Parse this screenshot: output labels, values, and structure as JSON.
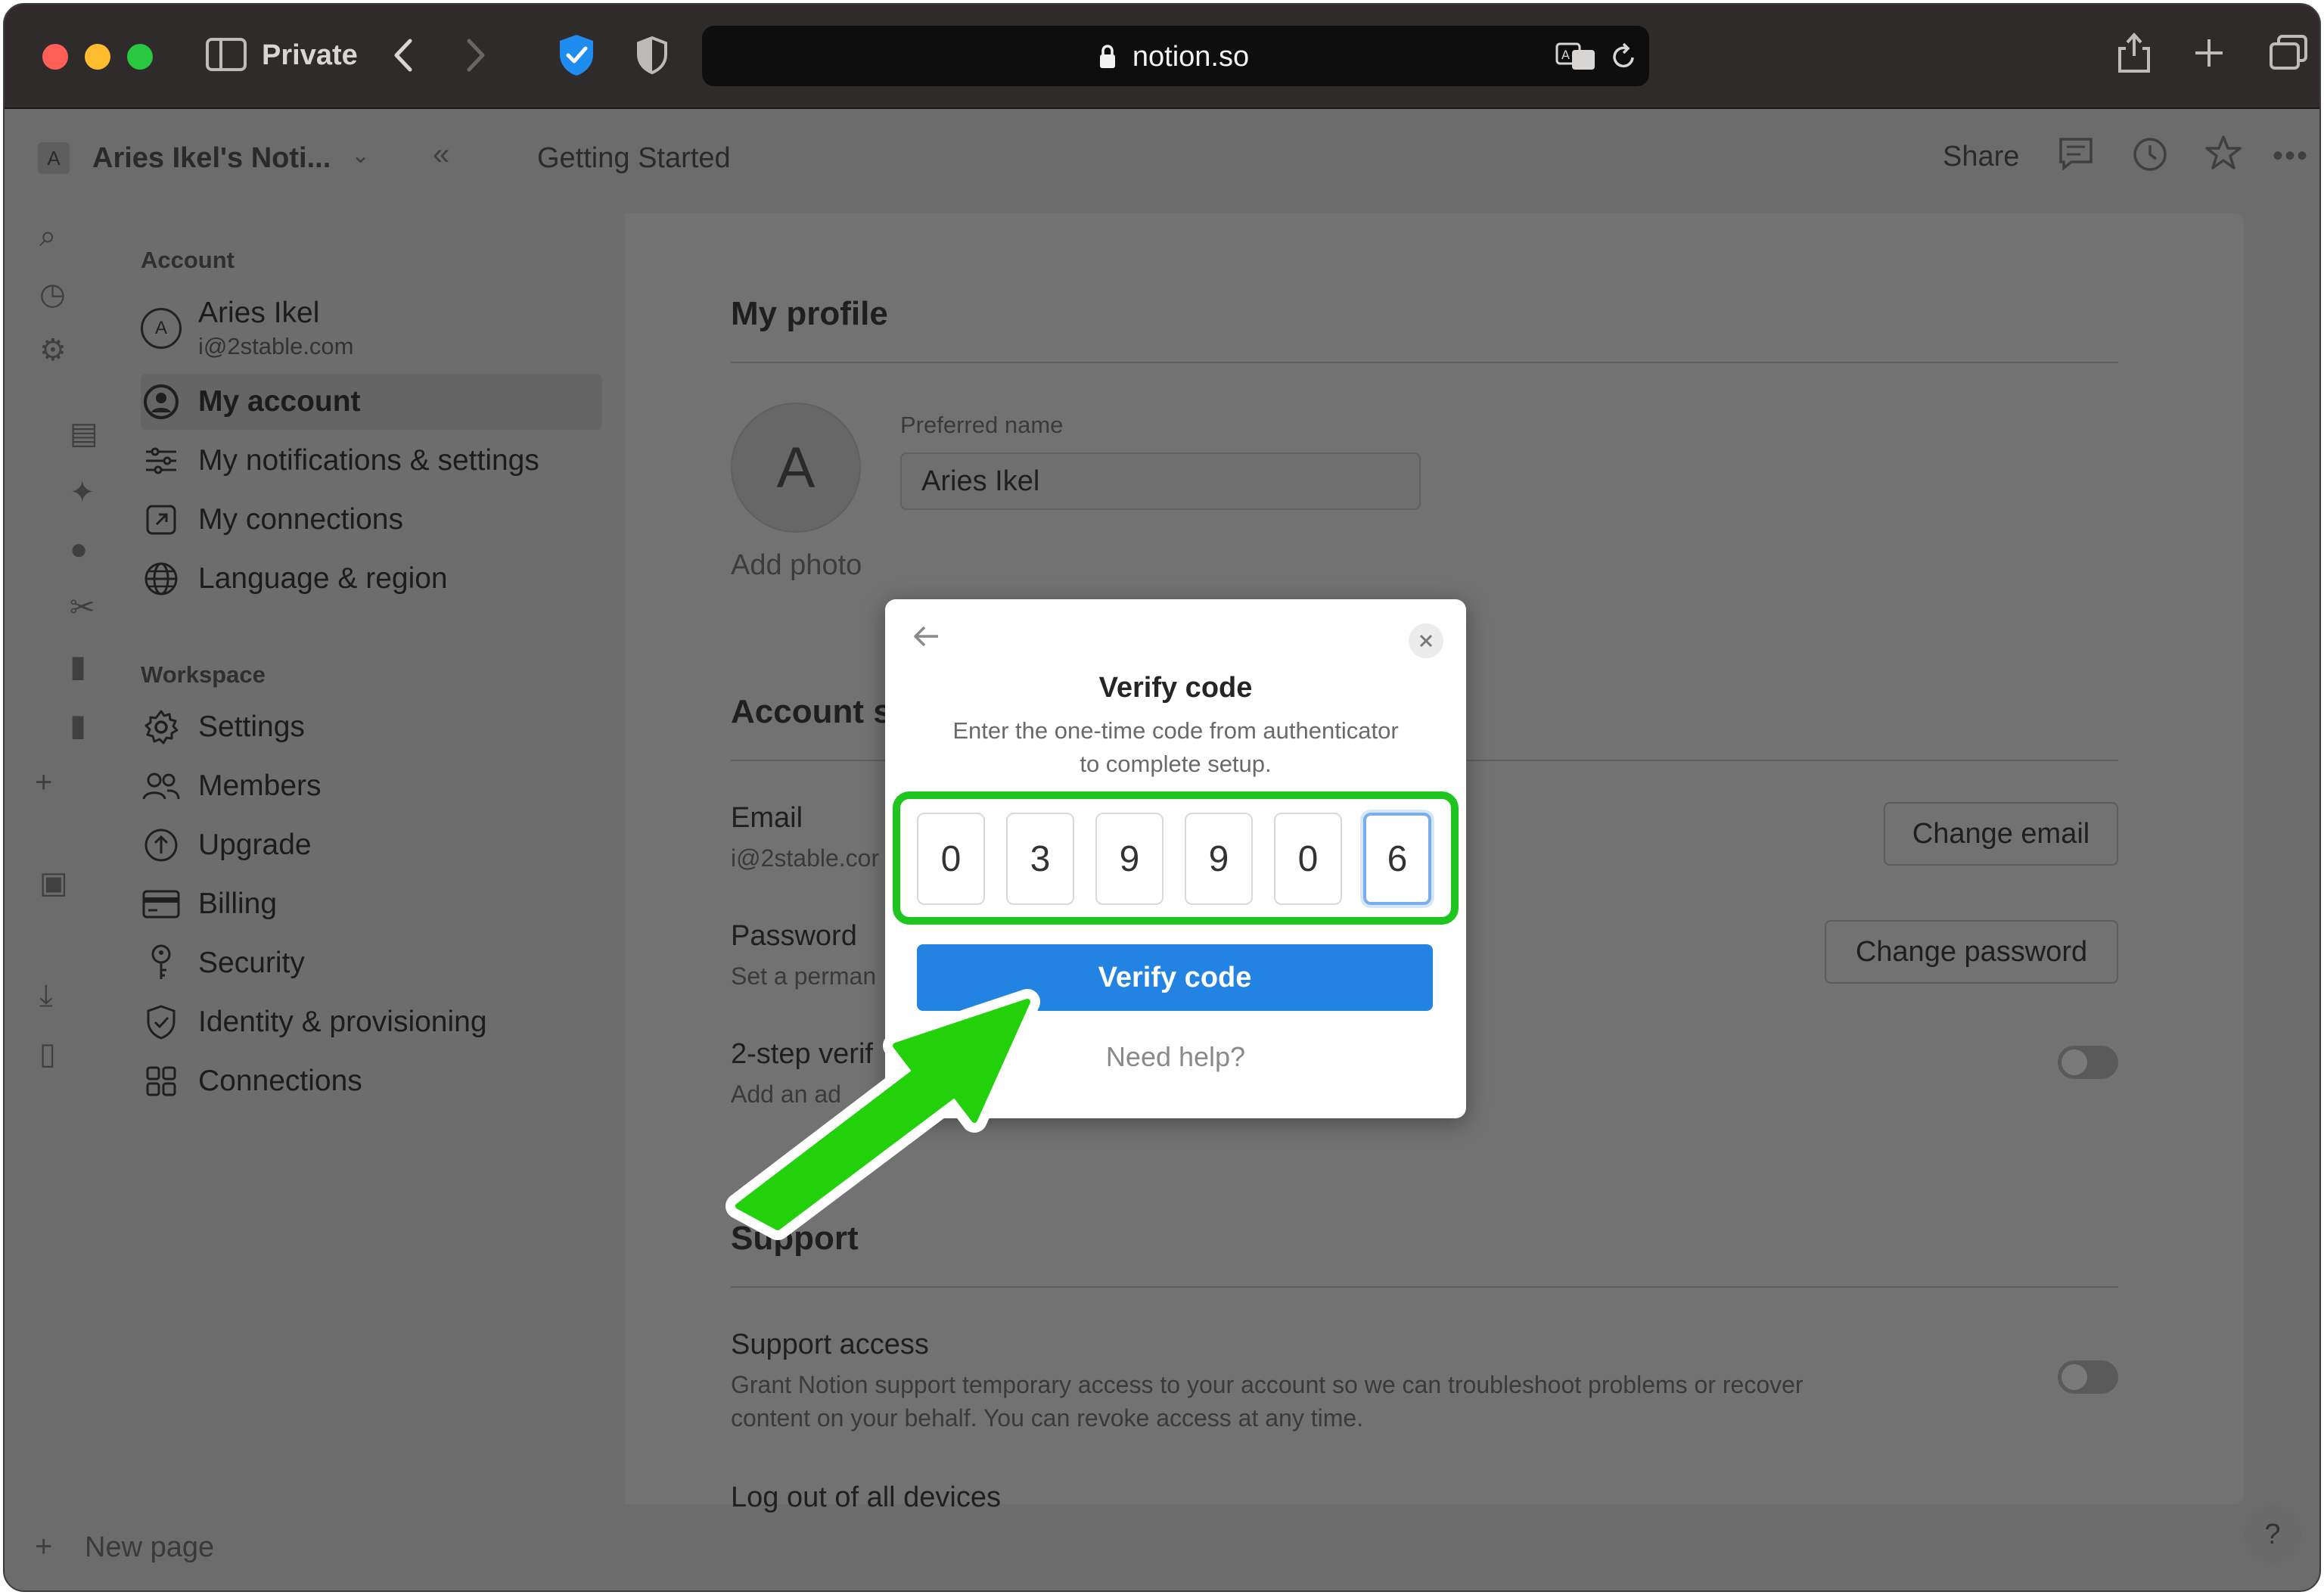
{
  "browser": {
    "profile_label": "Private",
    "address": "notion.so"
  },
  "notion": {
    "workspace_name": "Aries Ikel's Noti...",
    "workspace_initial": "A",
    "page_title": "Getting Started",
    "share_label": "Share",
    "new_page_label": "New page",
    "help_glyph": "?"
  },
  "settings": {
    "account_section": "Account",
    "user": {
      "name": "Aries Ikel",
      "email": "i@2stable.com",
      "initial": "A"
    },
    "account_items": [
      {
        "label": "My account",
        "icon": "user-circle-icon"
      },
      {
        "label": "My notifications & settings",
        "icon": "sliders-icon"
      },
      {
        "label": "My connections",
        "icon": "external-link-icon"
      },
      {
        "label": "Language & region",
        "icon": "globe-icon"
      }
    ],
    "workspace_section": "Workspace",
    "workspace_items": [
      {
        "label": "Settings",
        "icon": "gear-icon"
      },
      {
        "label": "Members",
        "icon": "people-icon"
      },
      {
        "label": "Upgrade",
        "icon": "upgrade-icon"
      },
      {
        "label": "Billing",
        "icon": "credit-card-icon"
      },
      {
        "label": "Security",
        "icon": "key-icon"
      },
      {
        "label": "Identity & provisioning",
        "icon": "shield-check-icon"
      },
      {
        "label": "Connections",
        "icon": "grid-icon"
      }
    ]
  },
  "profile": {
    "heading": "My profile",
    "avatar_initial": "A",
    "add_photo": "Add photo",
    "preferred_name_label": "Preferred name",
    "preferred_name_value": "Aries Ikel"
  },
  "account_security": {
    "heading_visible": "Account s",
    "email_label": "Email",
    "email_value": "i@2stable.cor",
    "change_email": "Change email",
    "password_label": "Password",
    "password_sub": "Set a perman",
    "change_password": "Change password",
    "two_step_label": "2-step verif",
    "two_step_sub": "Add an ad"
  },
  "support": {
    "heading": "Support",
    "access_label": "Support access",
    "access_desc_1": "Grant Notion support temporary access to your account so we can troubleshoot problems or recover",
    "access_desc_2": "content on your behalf. You can revoke access at any time.",
    "logout_label": "Log out of all devices"
  },
  "dialog": {
    "title": "Verify code",
    "desc_line1": "Enter the one-time code from authenticator",
    "desc_line2": "to complete setup.",
    "digits": [
      "0",
      "3",
      "9",
      "9",
      "0",
      "6"
    ],
    "verify_button": "Verify code",
    "help_link": "Need help?"
  },
  "colors": {
    "highlight": "#1ec51e",
    "primary_button": "#2383e2"
  }
}
